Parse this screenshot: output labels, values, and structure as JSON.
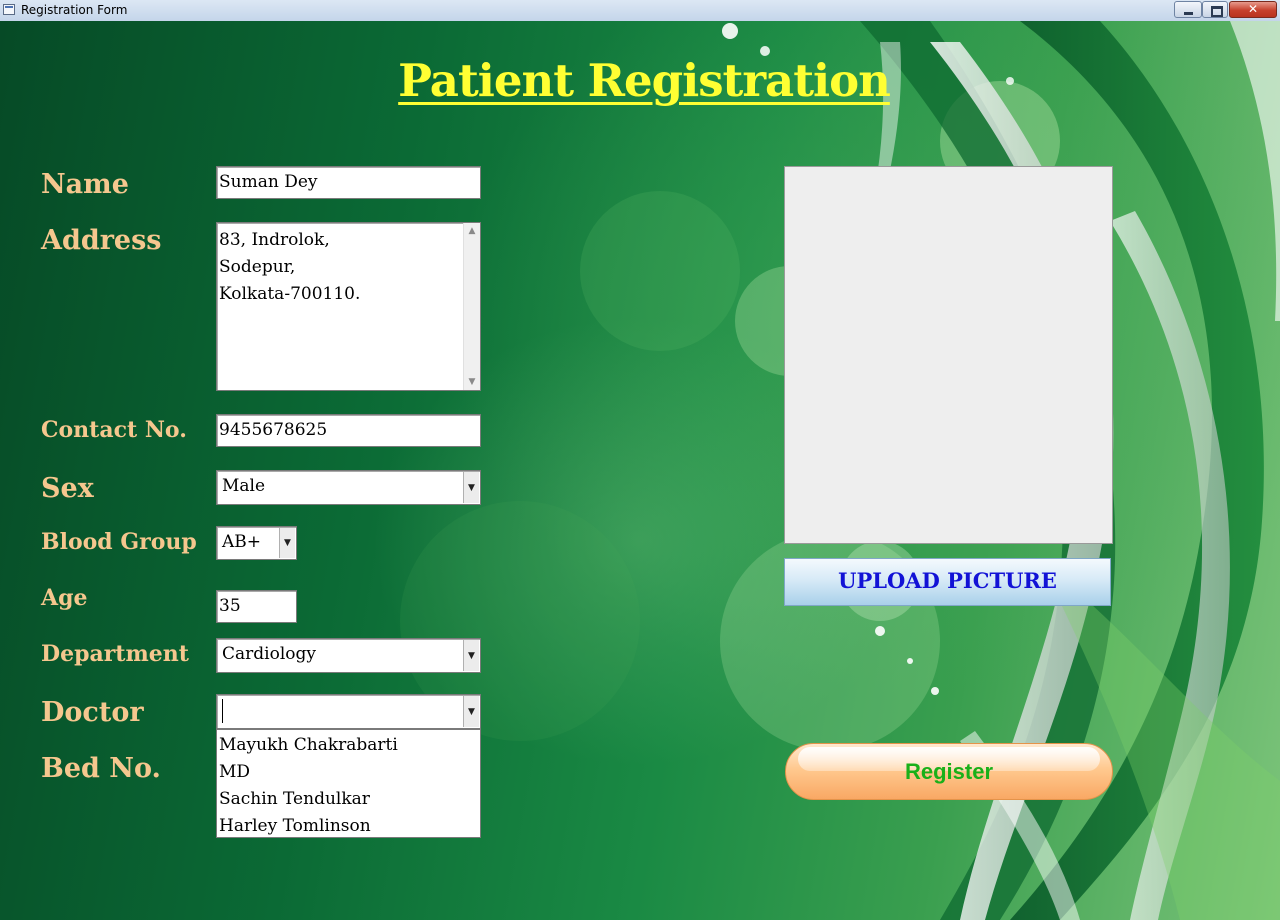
{
  "window": {
    "title": "Registration Form"
  },
  "form": {
    "title": "Patient Registration",
    "labels": {
      "name": "Name",
      "address": "Address",
      "contact": "Contact No.",
      "sex": "Sex",
      "blood_group": "Blood Group",
      "age": "Age",
      "department": "Department",
      "doctor": "Doctor",
      "bed": "Bed No."
    },
    "values": {
      "name": "Suman Dey",
      "address": "83, Indrolok,\nSodepur,\nKolkata-700110.",
      "contact": "9455678625",
      "sex": "Male",
      "blood_group": "AB+",
      "age": "35",
      "department": "Cardiology",
      "doctor": ""
    },
    "doctor_options": [
      "Mayukh Chakrabarti",
      "MD",
      "Sachin Tendulkar",
      "Harley Tomlinson"
    ]
  },
  "buttons": {
    "upload": "UPLOAD PICTURE",
    "register": "Register"
  },
  "icons": {
    "combo_arrow": "chevron-down-icon",
    "scroll_up": "scroll-up-icon",
    "scroll_down": "scroll-down-icon"
  },
  "colors": {
    "title": "#ffff33",
    "labels": "#f5c78e",
    "upload_text": "#1212d6",
    "register_text": "#19b019",
    "register_bg": "#ffc98f"
  }
}
